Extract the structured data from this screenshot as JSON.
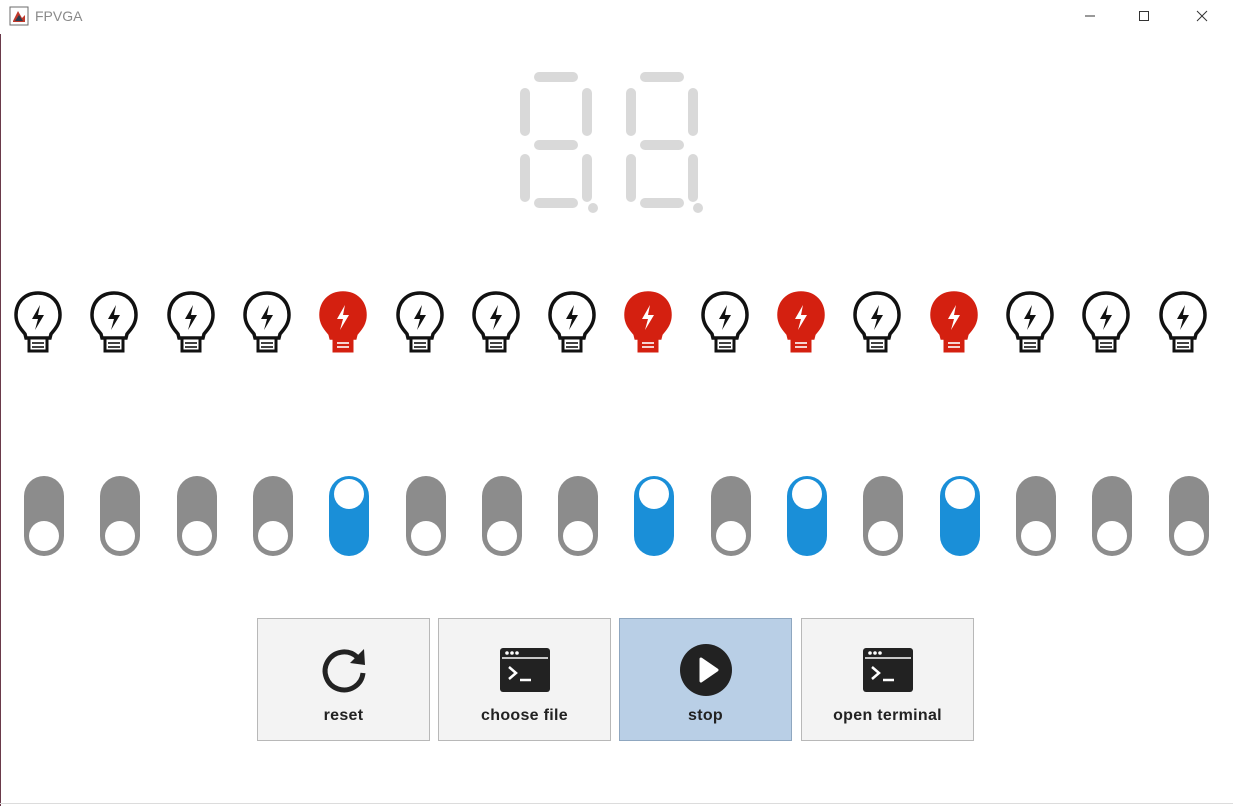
{
  "window": {
    "title": "FPVGA",
    "controls": [
      "minimize",
      "maximize",
      "close"
    ]
  },
  "display": {
    "type": "seven-segment",
    "digits": 2,
    "lit_segments": "none",
    "unlit_color": "#d9d9d9"
  },
  "leds": {
    "count": 16,
    "states": [
      false,
      false,
      false,
      false,
      true,
      false,
      false,
      false,
      true,
      false,
      true,
      false,
      true,
      false,
      false,
      false
    ],
    "on_color": "#d42010",
    "off_color": "#ffffff",
    "icon": "lightbulb-bolt-icon"
  },
  "switches": {
    "count": 16,
    "states": [
      false,
      false,
      false,
      false,
      true,
      false,
      false,
      false,
      true,
      false,
      true,
      false,
      true,
      false,
      false,
      false
    ],
    "on_color": "#1a8fd8",
    "off_color": "#8c8c8c"
  },
  "buttons": [
    {
      "id": "reset",
      "label": "reset",
      "icon": "reset-icon",
      "active": false
    },
    {
      "id": "choose-file",
      "label": "choose file",
      "icon": "terminal-icon",
      "active": false
    },
    {
      "id": "stop",
      "label": "stop",
      "icon": "play-icon",
      "active": true
    },
    {
      "id": "open-terminal",
      "label": "open terminal",
      "icon": "terminal-icon",
      "active": false
    }
  ]
}
